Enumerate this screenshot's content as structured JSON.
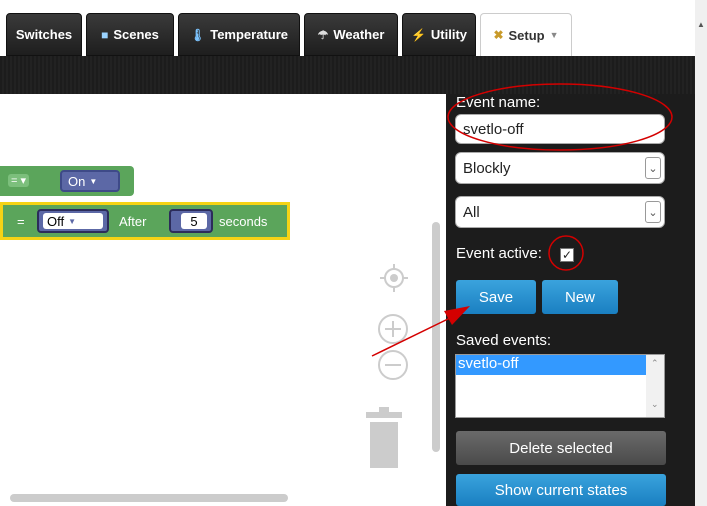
{
  "nav": {
    "tabs": [
      {
        "label": "Switches",
        "icon": ""
      },
      {
        "label": "Scenes",
        "icon": "scenes-icon"
      },
      {
        "label": "Temperature",
        "icon": "thermometer-icon"
      },
      {
        "label": "Weather",
        "icon": "weather-icon"
      },
      {
        "label": "Utility",
        "icon": "utility-icon"
      },
      {
        "label": "Setup",
        "icon": "tools-icon"
      }
    ]
  },
  "blockly": {
    "row1": {
      "value": "On"
    },
    "row2": {
      "value": "Off",
      "after_label": "After",
      "number": "5",
      "unit_label": "seconds"
    }
  },
  "panel": {
    "event_name_label": "Event name:",
    "event_name_value": "svetlo-off",
    "type_select": "Blockly",
    "scope_select": "All",
    "event_active_label": "Event active:",
    "event_active_checked": true,
    "save_label": "Save",
    "new_label": "New",
    "saved_events_label": "Saved events:",
    "saved_events": [
      "svetlo-off"
    ],
    "delete_label": "Delete selected",
    "show_states_label": "Show current states"
  },
  "colors": {
    "panel_bg": "#1c1c1c",
    "button_blue": "#1a7fc1",
    "block_green": "#5ba55b",
    "block_highlight": "#f5d315",
    "annotation_red": "#d40000"
  }
}
